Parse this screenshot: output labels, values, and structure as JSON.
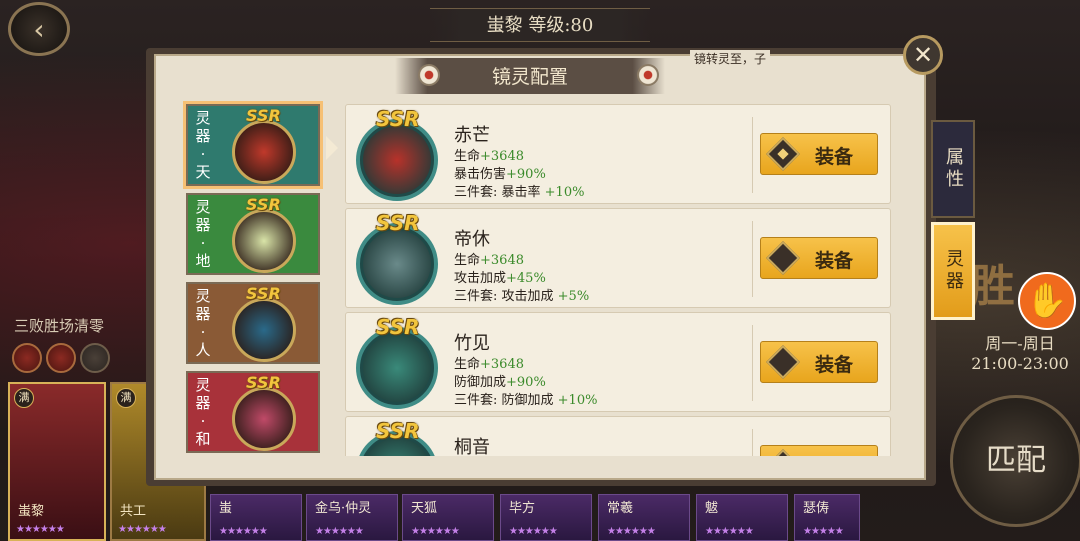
{
  "top_bar": {
    "back_icon": "back-arrow-icon",
    "title": "蚩黎 等级:80"
  },
  "left_panel": {
    "status_text": "三败胜场清零"
  },
  "modal": {
    "title": "镜灵配置",
    "scroll_text": "镜转灵至，子",
    "close_icon": "close-icon",
    "slots": [
      {
        "label_chars": [
          "灵",
          "器",
          "·",
          "天"
        ],
        "rarity": "SSR",
        "color": "#2f7a6e",
        "orb": "#c0392b"
      },
      {
        "label_chars": [
          "灵",
          "器",
          "·",
          "地"
        ],
        "rarity": "SSR",
        "color": "#3a8a3e",
        "orb": "#d9e4a8"
      },
      {
        "label_chars": [
          "灵",
          "器",
          "·",
          "人"
        ],
        "rarity": "SSR",
        "color": "#8a5a36",
        "orb": "#2a6a8a"
      },
      {
        "label_chars": [
          "灵",
          "器",
          "·",
          "和"
        ],
        "rarity": "SSR",
        "color": "#a8323a",
        "orb": "#c04a68"
      }
    ],
    "items": [
      {
        "rarity": "SSR",
        "name": "赤芒",
        "hp_label": "生命",
        "hp_value": "+3648",
        "stat_label": "暴击伤害",
        "stat_value": "+90%",
        "set_label": "三件套: 暴击率",
        "set_value": "+10%",
        "button": "装备",
        "button_icon": "equip-diamond-icon"
      },
      {
        "rarity": "SSR",
        "name": "帝休",
        "hp_label": "生命",
        "hp_value": "+3648",
        "stat_label": "攻击加成",
        "stat_value": "+45%",
        "set_label": "三件套: 攻击加成",
        "set_value": "+5%",
        "button": "装备",
        "button_icon": "equip-diamond-icon"
      },
      {
        "rarity": "SSR",
        "name": "竹见",
        "hp_label": "生命",
        "hp_value": "+3648",
        "stat_label": "防御加成",
        "stat_value": "+90%",
        "set_label": "三件套: 防御加成",
        "set_value": "+10%",
        "button": "装备",
        "button_icon": "equip-diamond-icon"
      },
      {
        "rarity": "SSR",
        "name": "桐音",
        "hp_label": "",
        "hp_value": "",
        "stat_label": "",
        "stat_value": "",
        "set_label": "",
        "set_value": "",
        "button": "",
        "button_icon": "equip-diamond-icon"
      }
    ]
  },
  "side_tabs": {
    "attributes": "属性",
    "spirit_gear": "灵器"
  },
  "right_panel": {
    "victory_text": "2胜",
    "schedule_days": "周一-周日",
    "schedule_time": "21:00-23:00",
    "match_button": "匹配"
  },
  "roster": {
    "cards": [
      {
        "name": "蚩黎",
        "tag": "满"
      },
      {
        "name": "共工",
        "tag": "满"
      }
    ],
    "lower": [
      "蚩",
      "金乌·仲灵",
      "天狐",
      "毕方",
      "常羲",
      "魃",
      "瑟俦"
    ]
  }
}
